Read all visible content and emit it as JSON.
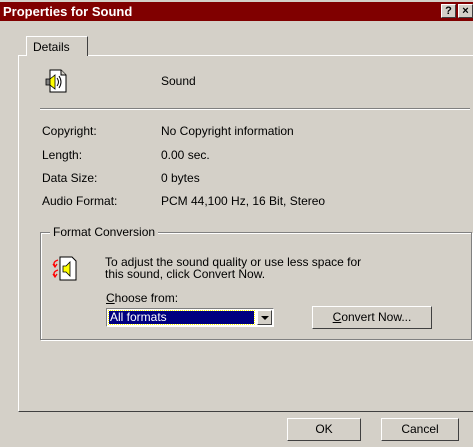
{
  "window": {
    "title": "Properties for Sound",
    "help_glyph": "?",
    "close_glyph": "×"
  },
  "tabs": [
    {
      "label": "Details"
    }
  ],
  "details": {
    "name": "Sound",
    "copyright_label": "Copyright:",
    "copyright_value": "No Copyright information",
    "length_label": "Length:",
    "length_value": "0.00 sec.",
    "size_label": "Data Size:",
    "size_value": "0 bytes",
    "format_label": "Audio Format:",
    "format_value": "PCM 44,100 Hz, 16 Bit, Stereo"
  },
  "format_conversion": {
    "group_title": "Format Conversion",
    "line1": "To adjust the sound quality or use less space for",
    "line2": "this sound, click Convert Now.",
    "choose_prefix": "C",
    "choose_rest": "hoose from:",
    "selected_format": "All formats",
    "convert_prefix": "C",
    "convert_rest": "onvert Now..."
  },
  "buttons": {
    "ok": "OK",
    "cancel": "Cancel"
  },
  "colors": {
    "title_bar": "#800000",
    "dialog_bg": "#d4d0c8",
    "selection": "#000080"
  }
}
